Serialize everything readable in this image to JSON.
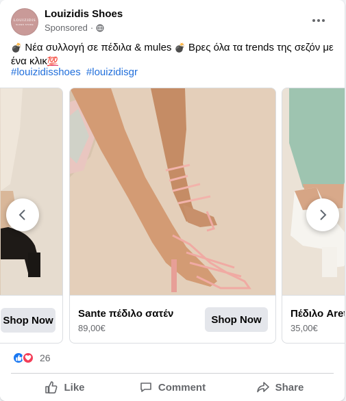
{
  "post": {
    "page_name": "Louizidis Shoes",
    "avatar_text": "LOUIZIDIS",
    "avatar_subtext": "SHOES STORE",
    "sponsored_label": "Sponsored",
    "separator": "·",
    "text_part1": "Νέα συλλογή σε πέδιλα & mules",
    "text_part2": "Βρες όλα τα trends της σεζόν με ένα κλικ",
    "hundred_emoji": "💯",
    "hashtags": [
      "#louizidisshoes",
      "#louizidisgr"
    ]
  },
  "carousel": {
    "cards": [
      {
        "name": "",
        "price": "",
        "button_label": "Shop Now"
      },
      {
        "name": "Sante πέδιλο σατέν",
        "price": "89,00€",
        "button_label": "Shop Now"
      },
      {
        "name": "Πέδιλο Aret",
        "price": "35,00€",
        "button_label": ""
      }
    ]
  },
  "reactions": {
    "count": "26",
    "types": [
      "like-icon",
      "love-icon"
    ]
  },
  "actions": [
    {
      "label": "Like",
      "icon": "thumbs-up-icon"
    },
    {
      "label": "Comment",
      "icon": "comment-bubble-icon"
    },
    {
      "label": "Share",
      "icon": "share-arrow-icon"
    }
  ],
  "colors": {
    "link": "#216fdb",
    "secondary_text": "#65676b",
    "button_bg": "#e4e6eb",
    "like_blue": "#1877f2",
    "love_red": "#f33e58"
  }
}
